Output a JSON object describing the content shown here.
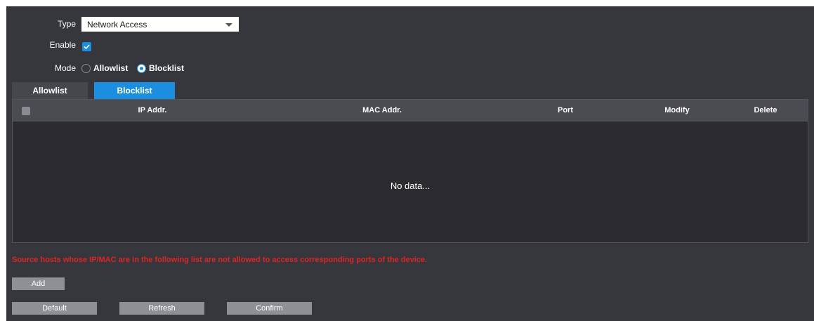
{
  "form": {
    "type_label": "Type",
    "type_value": "Network Access",
    "enable_label": "Enable",
    "enable_checked": true,
    "mode_label": "Mode",
    "mode_options": [
      "Allowlist",
      "Blocklist"
    ],
    "mode_selected": "Blocklist"
  },
  "tabs": [
    {
      "label": "Allowlist",
      "active": false
    },
    {
      "label": "Blocklist",
      "active": true
    }
  ],
  "table": {
    "columns": [
      "IP Addr.",
      "MAC Addr.",
      "Port",
      "Modify",
      "Delete"
    ],
    "rows": [],
    "empty_text": "No data..."
  },
  "warning": "Source hosts whose IP/MAC are in the following list are not allowed to access corresponding ports of the device.",
  "buttons": {
    "add": "Add",
    "default": "Default",
    "refresh": "Refresh",
    "confirm": "Confirm"
  },
  "colors": {
    "background": "#36363d",
    "accent": "#1b8ee0",
    "warning": "#e02424",
    "button": "#8f8f96"
  },
  "icons": {
    "dropdown": "chevron-down-icon",
    "checkbox": "checkmark-icon"
  }
}
